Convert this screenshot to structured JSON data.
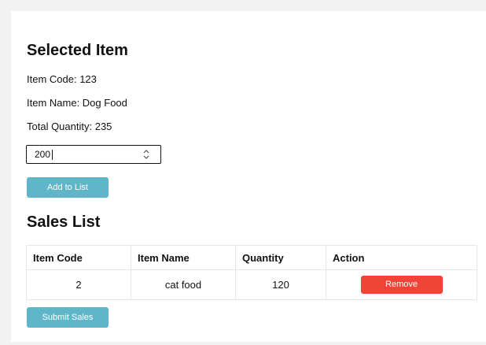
{
  "selected_item": {
    "title": "Selected Item",
    "item_code": "Item Code: 123",
    "item_name": "Item Name: Dog Food",
    "total_quantity": "Total Quantity: 235",
    "quantity_input_value": "200",
    "add_button_label": "Add to List"
  },
  "sales_list": {
    "title": "Sales List",
    "columns": [
      "Item Code",
      "Item Name",
      "Quantity",
      "Action"
    ],
    "rows": [
      {
        "item_code": "2",
        "item_name": "cat food",
        "quantity": "120",
        "action_label": "Remove"
      }
    ],
    "submit_button_label": "Submit Sales"
  },
  "colors": {
    "primary_button": "#5fb6c9",
    "danger_button": "#ef4436"
  }
}
